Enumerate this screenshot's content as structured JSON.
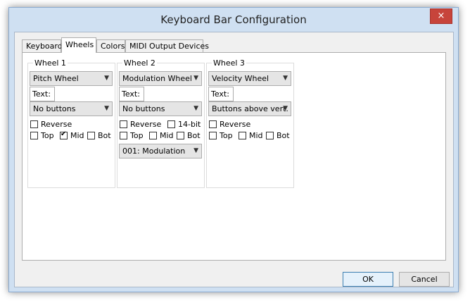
{
  "window": {
    "title": "Keyboard Bar Configuration",
    "close_icon": "×"
  },
  "tabs": [
    {
      "label": "Keyboard",
      "active": false
    },
    {
      "label": "Wheels",
      "active": true
    },
    {
      "label": "Colors",
      "active": false
    },
    {
      "label": "MIDI Output Devices",
      "active": false
    }
  ],
  "wheels": [
    {
      "title": "Wheel 1",
      "type": "Pitch Wheel",
      "text_label": "Text:",
      "text_value": "",
      "buttons": "No buttons",
      "reverse_label": "Reverse",
      "top_label": "Top",
      "mid_label": "Mid",
      "bot_label": "Bot"
    },
    {
      "title": "Wheel 2",
      "type": "Modulation Wheel",
      "text_label": "Text:",
      "text_value": "",
      "buttons": "No buttons",
      "reverse_label": "Reverse",
      "bit14_label": "14-bit",
      "top_label": "Top",
      "mid_label": "Mid",
      "bot_label": "Bot",
      "controller": "001: Modulation"
    },
    {
      "title": "Wheel 3",
      "type": "Velocity Wheel",
      "text_label": "Text:",
      "text_value": "",
      "buttons": "Buttons above vert.",
      "reverse_label": "Reverse",
      "top_label": "Top",
      "mid_label": "Mid",
      "bot_label": "Bot"
    }
  ],
  "footer": {
    "ok_label": "OK",
    "cancel_label": "Cancel"
  }
}
